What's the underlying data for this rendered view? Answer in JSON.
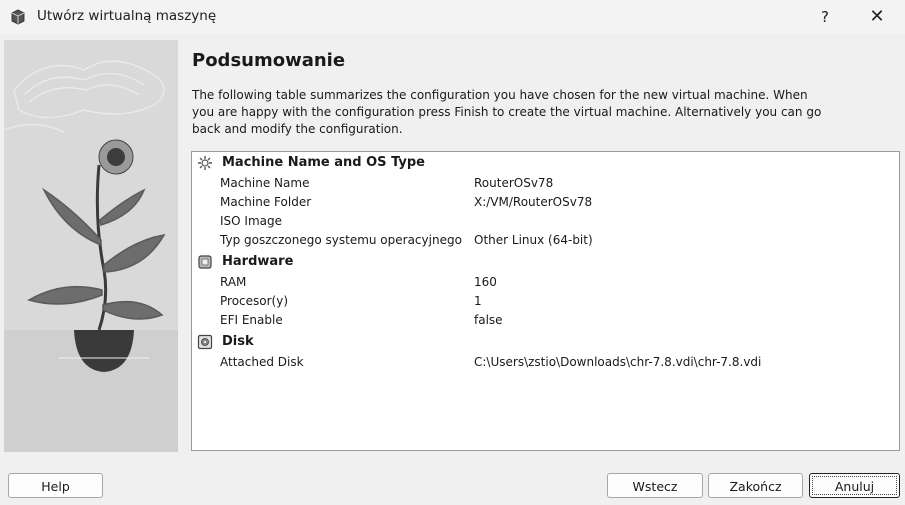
{
  "window": {
    "title": "Utwórz wirtualną maszynę",
    "help_glyph": "?",
    "close_glyph": "✕"
  },
  "page": {
    "heading": "Podsumowanie",
    "description": "The following table summarizes the configuration you have chosen for the new virtual machine. When you are happy with the configuration press Finish to create the virtual machine. Alternatively you can go back and modify the configuration."
  },
  "summary": {
    "sections": [
      {
        "title": "Machine Name and OS Type",
        "icon": "machine-icon",
        "rows": [
          {
            "key": "Machine Name",
            "value": "RouterOSv78"
          },
          {
            "key": "Machine Folder",
            "value": "X:/VM/RouterOSv78"
          },
          {
            "key": "ISO Image",
            "value": ""
          },
          {
            "key": "Typ goszczonego systemu operacyjnego",
            "value": "Other Linux (64-bit)"
          }
        ]
      },
      {
        "title": "Hardware",
        "icon": "chip-icon",
        "rows": [
          {
            "key": "RAM",
            "value": "160"
          },
          {
            "key": "Procesor(y)",
            "value": "1"
          },
          {
            "key": "EFI Enable",
            "value": "false"
          }
        ]
      },
      {
        "title": "Disk",
        "icon": "disk-icon",
        "rows": [
          {
            "key": "Attached Disk",
            "value": "C:\\Users\\zstio\\Downloads\\chr-7.8.vdi\\chr-7.8.vdi"
          }
        ]
      }
    ]
  },
  "buttons": {
    "help": "Help",
    "back": "Wstecz",
    "finish": "Zakończ",
    "cancel": "Anuluj"
  }
}
